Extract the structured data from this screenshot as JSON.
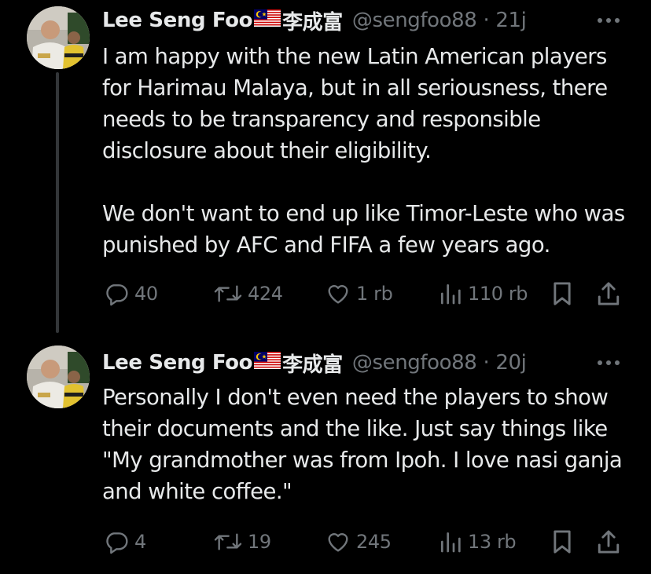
{
  "colors": {
    "background": "#000000",
    "primary_text": "#e7e9ea",
    "secondary_text": "#71767b",
    "thread_line": "#333639"
  },
  "tweets": [
    {
      "display_name": "Lee Seng Foo",
      "name_flag_icon": "malaysia-flag-icon",
      "name_chinese": "李成富",
      "handle": "@sengfoo88",
      "separator": "·",
      "time": "21j",
      "body": "I am happy with the new Latin American players for Harimau Malaya, but in all seriousness, there needs to be transparency and responsible disclosure about their eligibility.\n\nWe don't want to end up like Timor-Leste who was punished by AFC and FIFA a few years ago.",
      "replies": "40",
      "reposts": "424",
      "likes": "1 rb",
      "views": "110 rb"
    },
    {
      "display_name": "Lee Seng Foo",
      "name_flag_icon": "malaysia-flag-icon",
      "name_chinese": "李成富",
      "handle": "@sengfoo88",
      "separator": "·",
      "time": "20j",
      "body": "Personally I don't even need the players to show their documents and the like. Just say things like \"My grandmother was from Ipoh. I love nasi ganja and white coffee.\"",
      "replies": "4",
      "reposts": "19",
      "likes": "245",
      "views": "13 rb"
    }
  ]
}
